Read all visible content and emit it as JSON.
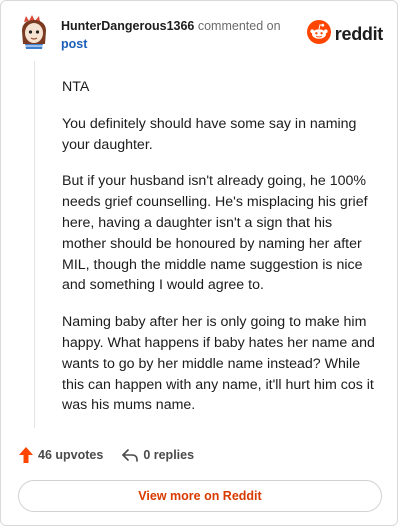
{
  "header": {
    "author": "HunterDangerous1366",
    "action_text": "commented on",
    "post_link": "post",
    "logo_text": "reddit"
  },
  "comment": {
    "paragraphs": [
      "NTA",
      "You definitely should have some say in naming your daughter.",
      "But if your husband isn't already going, he 100% needs grief counselling. He's misplacing his grief here, having a daughter isn't a sign that his mother should be honoured by naming her after MIL, though the middle name suggestion is nice and something I would agree to.",
      "Naming baby after her is only going to make him happy. What happens if baby hates her name and wants to go by her middle name instead? While this can happen with any name, it'll hurt him cos it was his mums name."
    ]
  },
  "actions": {
    "upvotes_label": "46 upvotes",
    "replies_label": "0 replies"
  },
  "footer": {
    "view_more_label": "View more on Reddit"
  },
  "colors": {
    "brand": "#ff4500",
    "link": "#1c5fb8",
    "view_more": "#d93a00",
    "muted": "#6b6b6b"
  },
  "icons": {
    "avatar": "avatar-icon",
    "logo": "reddit-logo-icon",
    "upvote": "upvote-arrow-icon",
    "reply": "reply-arrow-icon"
  }
}
